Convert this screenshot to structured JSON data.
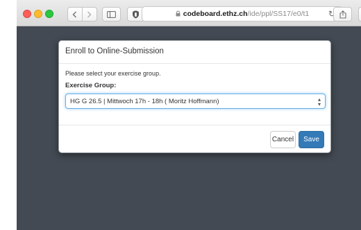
{
  "browser": {
    "url_host": "codeboard.ethz.ch",
    "url_path": "/ide/ppl/SS17/e0/t1",
    "icons": {
      "back": "chevron-left-icon",
      "forward": "chevron-right-icon",
      "sidebar": "sidebar-icon",
      "shield": "shield-icon",
      "lock": "lock-icon",
      "reload": "reload-icon",
      "share": "share-icon",
      "tabs": "tabs-icon"
    }
  },
  "modal": {
    "title": "Enroll to Online-Submission",
    "body_text": "Please select your exercise group.",
    "group_label": "Exercise Group:",
    "selected_group": "HG G 26.5 | Mittwoch 17h - 18h ( Moritz Hoffmann)",
    "cancel_label": "Cancel",
    "save_label": "Save"
  },
  "colors": {
    "backdrop": "#434a53",
    "save_button": "#337ab7",
    "select_focus": "#66afe9"
  }
}
